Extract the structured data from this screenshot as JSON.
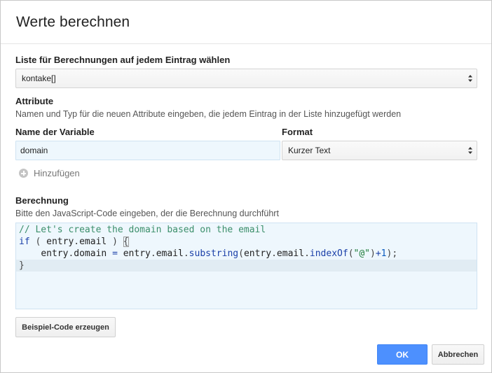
{
  "dialog": {
    "title": "Werte berechnen"
  },
  "list_section": {
    "label": "Liste für Berechnungen auf jedem Eintrag wählen",
    "selected_value": "kontake[]"
  },
  "attribute_section": {
    "label": "Attribute",
    "description": "Namen und Typ für die neuen Attribute eingeben, die jedem Eintrag in der Liste hinzugefügt werden",
    "variable_header": "Name der Variable",
    "format_header": "Format",
    "rows": [
      {
        "variable": "domain",
        "format": "Kurzer Text"
      }
    ],
    "add_label": "Hinzufügen"
  },
  "calculation_section": {
    "label": "Berechnung",
    "description": "Bitte den JavaScript-Code eingeben, der die Berechnung durchführt",
    "code_lines": [
      "// Let's create the domain based on the email",
      "if ( entry.email ) {",
      "    entry.domain = entry.email.substring(entry.email.indexOf(\"@\")+1);",
      "}"
    ],
    "example_button": "Beispiel-Code erzeugen"
  },
  "footer": {
    "ok_label": "OK",
    "cancel_label": "Abbrechen"
  },
  "colors": {
    "primary_button": "#4d90fe",
    "input_background": "#eef7fd"
  },
  "icons": {
    "select_arrows": "up-down-arrows-icon",
    "add": "plus-circle-icon"
  }
}
